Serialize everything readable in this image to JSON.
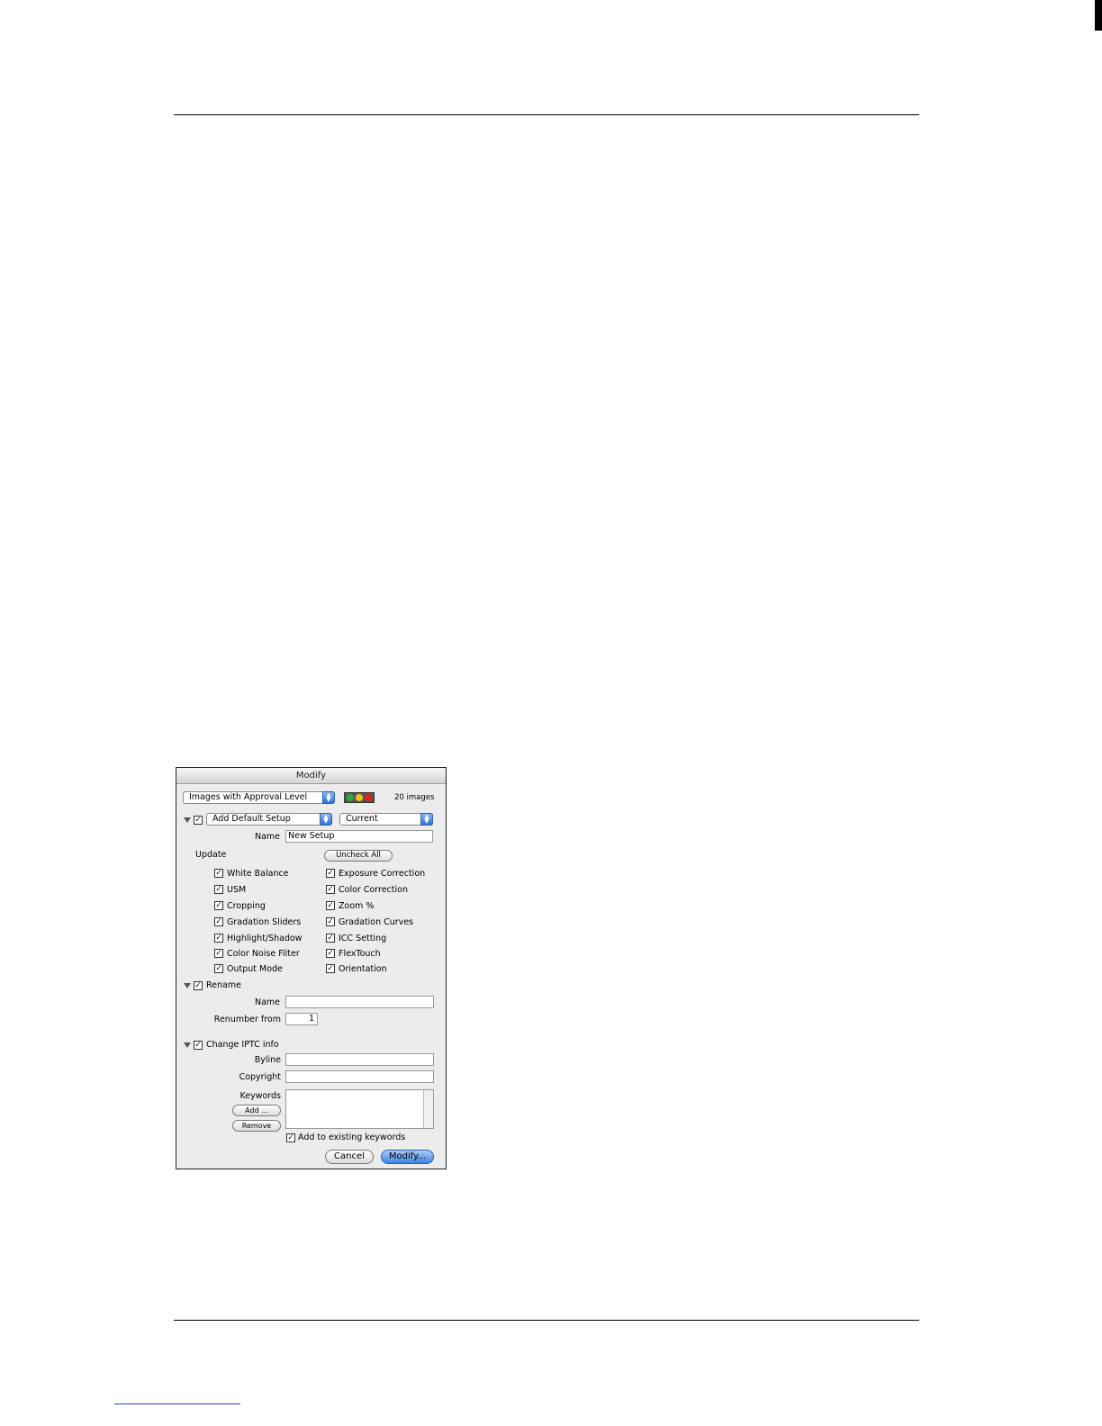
{
  "dialog": {
    "title": "Modify",
    "filter_popup": "Images with Approval Level",
    "images_count": "20 images",
    "setup_popup": "Add Default Setup",
    "setup_source_popup": "Current",
    "name_label": "Name",
    "name_value": "New Setup",
    "update_label": "Update",
    "uncheck_all_button": "Uncheck All",
    "options_left": [
      "White Balance",
      "USM",
      "Cropping",
      "Gradation Sliders",
      "Highlight/Shadow",
      "Color Noise Filter",
      "Output Mode"
    ],
    "options_right": [
      "Exposure Correction",
      "Color Correction",
      "Zoom %",
      "Gradation Curves",
      "ICC Setting",
      "FlexTouch",
      "Orientation"
    ],
    "rename_label": "Rename",
    "rename_name_label": "Name",
    "rename_name_value": "",
    "renumber_label": "Renumber from",
    "renumber_value": "1",
    "iptc_label": "Change IPTC info",
    "byline_label": "Byline",
    "byline_value": "",
    "copyright_label": "Copyright",
    "copyright_value": "",
    "keywords_label": "Keywords",
    "add_button": "Add ...",
    "remove_button": "Remove",
    "add_existing_label": "Add to existing keywords",
    "cancel_button": "Cancel",
    "modify_button": "Modify...",
    "check_mark": "✓",
    "disclosure_icon": "triangle-down-icon",
    "approval_colors": [
      "#2fa83a",
      "#f2c21b",
      "#e02020"
    ]
  }
}
